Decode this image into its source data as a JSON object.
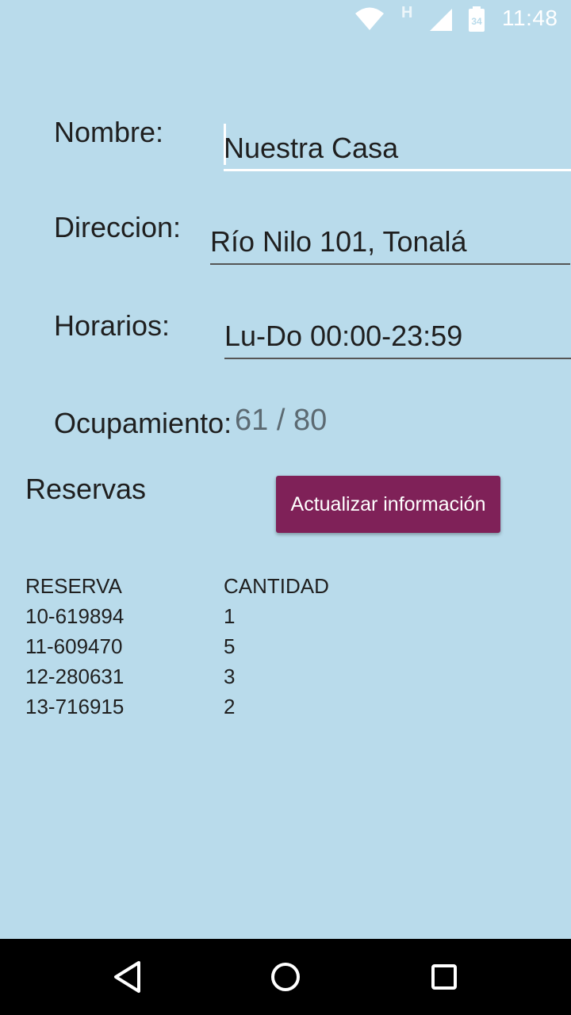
{
  "status_bar": {
    "network_type": "H",
    "battery_level": "34",
    "time": "11:48",
    "icons": [
      "wifi-icon",
      "signal-icon",
      "battery-icon"
    ]
  },
  "form": {
    "nombre": {
      "label": "Nombre:",
      "value": "Nuestra Casa"
    },
    "direccion": {
      "label": "Direccion:",
      "value": "Río Nilo 101, Tonalá"
    },
    "horarios": {
      "label": "Horarios:",
      "value": "Lu-Do 00:00-23:59"
    },
    "ocupamiento": {
      "label": "Ocupamiento:",
      "value": "61 / 80"
    }
  },
  "reservas": {
    "title": "Reservas",
    "button_label": "Actualizar información",
    "columns": [
      "RESERVA",
      "CANTIDAD"
    ],
    "rows": [
      [
        "10-619894",
        "1"
      ],
      [
        "11-609470",
        "5"
      ],
      [
        "12-280631",
        "3"
      ],
      [
        "13-716915",
        "2"
      ]
    ]
  },
  "colors": {
    "background": "#b9dbeb",
    "button": "#7f2158",
    "navbar": "#000000"
  },
  "nav_bar": {
    "icons": [
      "back-icon",
      "home-icon",
      "recent-apps-icon"
    ]
  }
}
